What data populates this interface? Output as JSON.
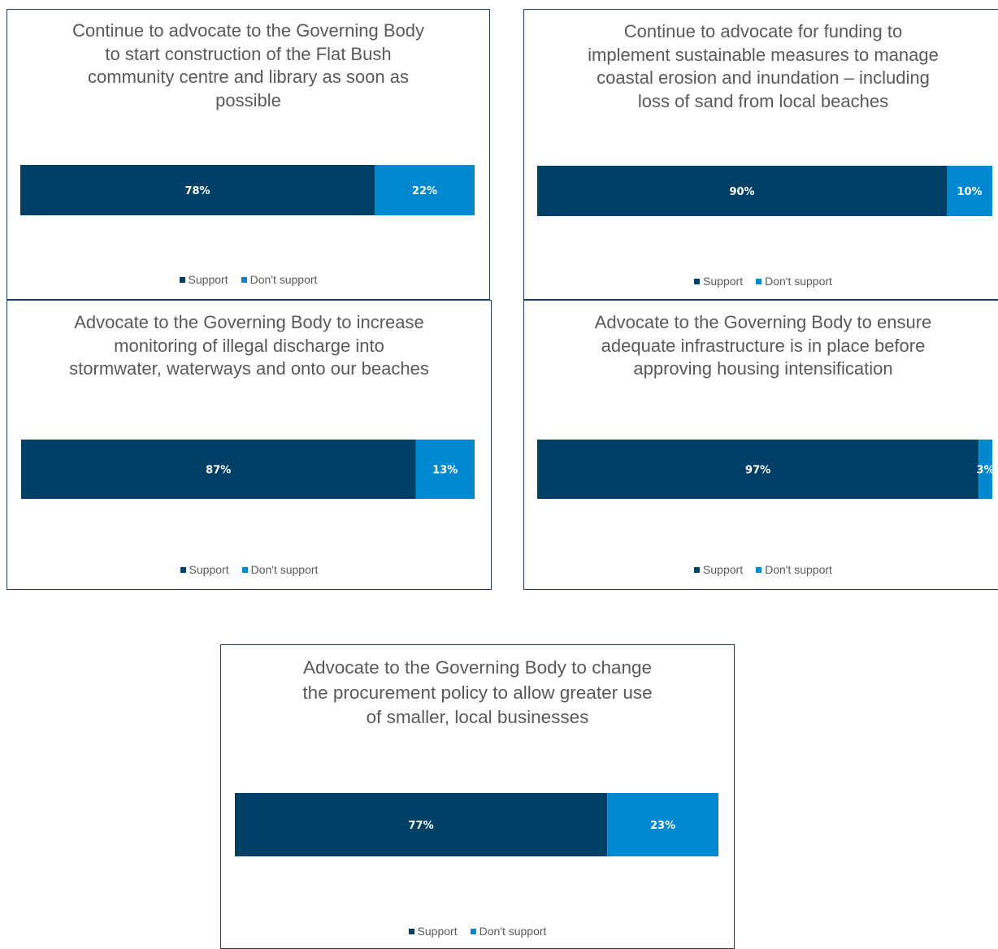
{
  "colors": {
    "support": "#003f66",
    "dont_support": "#0288d0"
  },
  "chart_data": [
    {
      "type": "bar",
      "stacked": true,
      "orientation": "horizontal",
      "title": "Continue to advocate to the Governing Body\nto start construction of the Flat Bush\ncommunity centre and library as soon as\npossible",
      "series": [
        {
          "name": "Support",
          "values": [
            78
          ],
          "label": "78%"
        },
        {
          "name": "Don't support",
          "values": [
            22
          ],
          "label": "22%"
        }
      ],
      "xlim": [
        0,
        100
      ],
      "legend_position": "bottom"
    },
    {
      "type": "bar",
      "stacked": true,
      "orientation": "horizontal",
      "title": "Continue to advocate for funding to\nimplement sustainable measures to manage\ncoastal erosion and inundation – including\nloss of sand from local beaches",
      "series": [
        {
          "name": "Support",
          "values": [
            90
          ],
          "label": "90%"
        },
        {
          "name": "Don't support",
          "values": [
            10
          ],
          "label": "10%"
        }
      ],
      "xlim": [
        0,
        100
      ],
      "legend_position": "bottom"
    },
    {
      "type": "bar",
      "stacked": true,
      "orientation": "horizontal",
      "title": "Advocate to the Governing Body to increase\nmonitoring of illegal discharge into\nstormwater, waterways and onto our beaches",
      "series": [
        {
          "name": "Support",
          "values": [
            87
          ],
          "label": "87%"
        },
        {
          "name": "Don't support",
          "values": [
            13
          ],
          "label": "13%"
        }
      ],
      "xlim": [
        0,
        100
      ],
      "legend_position": "bottom"
    },
    {
      "type": "bar",
      "stacked": true,
      "orientation": "horizontal",
      "title": "Advocate to the Governing Body to ensure\nadequate infrastructure is in place before\napproving housing intensification",
      "series": [
        {
          "name": "Support",
          "values": [
            97
          ],
          "label": "97%"
        },
        {
          "name": "Don't support",
          "values": [
            3
          ],
          "label": "3%"
        }
      ],
      "xlim": [
        0,
        100
      ],
      "legend_position": "bottom"
    },
    {
      "type": "bar",
      "stacked": true,
      "orientation": "horizontal",
      "title": "Advocate to the Governing Body to change\nthe procurement policy to allow greater use\nof smaller, local businesses",
      "series": [
        {
          "name": "Support",
          "values": [
            77
          ],
          "label": "77%"
        },
        {
          "name": "Don't support",
          "values": [
            23
          ],
          "label": "23%"
        }
      ],
      "xlim": [
        0,
        100
      ],
      "legend_position": "bottom"
    }
  ]
}
